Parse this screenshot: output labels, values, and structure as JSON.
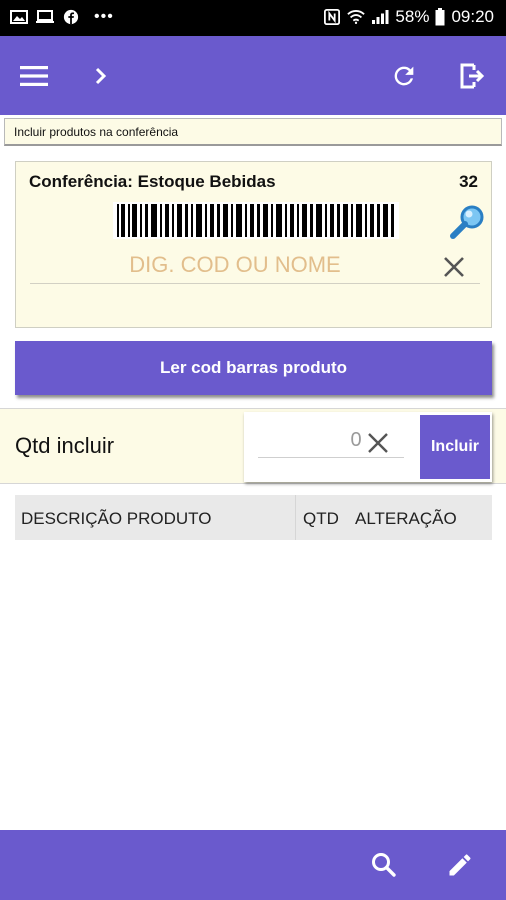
{
  "status_bar": {
    "battery": "58%",
    "time": "09:20",
    "left_icons": [
      "gallery-icon",
      "cast-icon",
      "facebook-icon",
      "more-dots-icon"
    ],
    "right_icons": [
      "nfc-icon",
      "wifi-icon",
      "signal-icon",
      "battery-icon"
    ]
  },
  "app_bar": {
    "icons": [
      "menu-icon",
      "chevron-right-icon",
      "refresh-icon",
      "exit-icon"
    ]
  },
  "info_strip": {
    "text": "Incluir produtos na conferência"
  },
  "card": {
    "title": "Conferência: Estoque Bebidas",
    "count": "32",
    "search_placeholder": "DIG. COD OU NOME",
    "search_value": ""
  },
  "scan_button": {
    "label": "Ler cod barras produto"
  },
  "qtd": {
    "label": "Qtd incluir",
    "value": "0",
    "button_label": "Incluir"
  },
  "table": {
    "columns": [
      "DESCRIÇÃO PRODUTO",
      "QTD",
      "ALTERAÇÃO"
    ],
    "rows": []
  },
  "bottom_bar": {
    "icons": [
      "search-icon",
      "edit-icon"
    ]
  },
  "colors": {
    "primary": "#6a5acd",
    "panel_bg": "#fdfbe6",
    "placeholder": "#e2be8c"
  }
}
